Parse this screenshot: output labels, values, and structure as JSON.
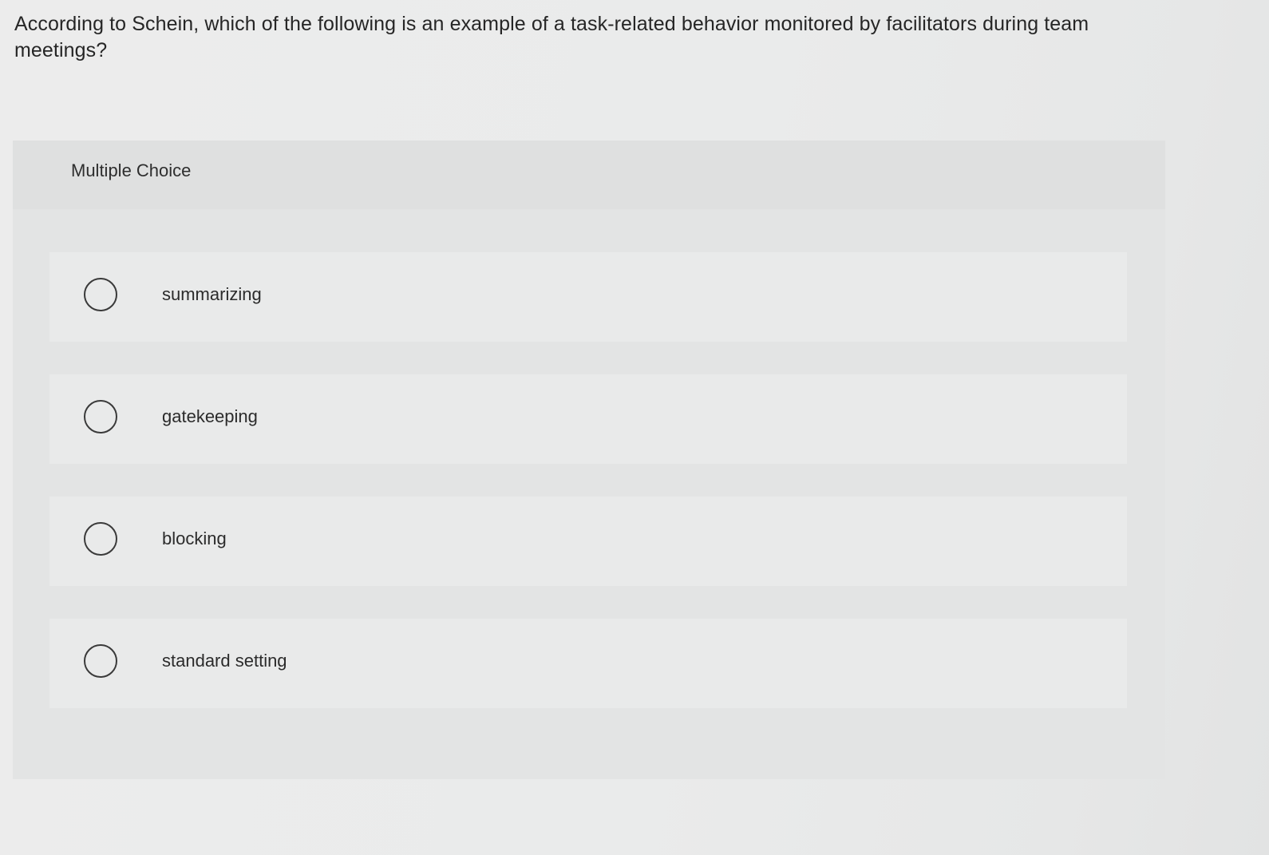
{
  "question": {
    "text": "According to Schein, which of the following is an example of a task-related behavior monitored by facilitators during team meetings?"
  },
  "multiple_choice": {
    "header": "Multiple Choice",
    "options": [
      {
        "label": "summarizing",
        "selected": false
      },
      {
        "label": "gatekeeping",
        "selected": false
      },
      {
        "label": "blocking",
        "selected": false
      },
      {
        "label": "standard setting",
        "selected": false
      }
    ]
  }
}
